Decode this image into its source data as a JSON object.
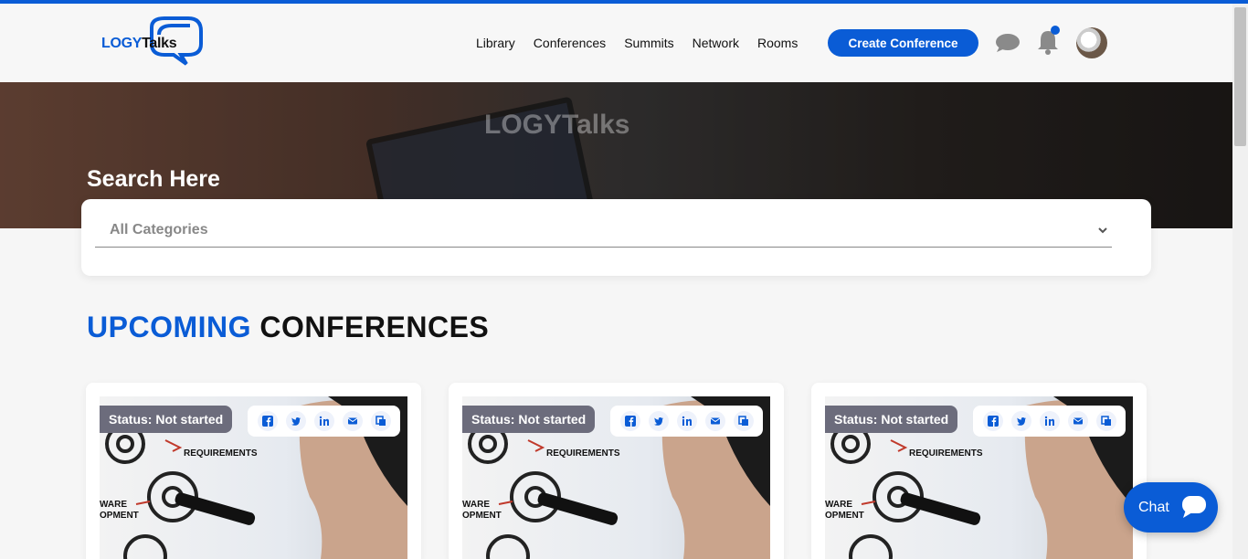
{
  "logo": {
    "part1": "LOGY",
    "part2": "Talks"
  },
  "nav": {
    "links": [
      "Library",
      "Conferences",
      "Summits",
      "Network",
      "Rooms"
    ],
    "create_label": "Create Conference",
    "icons": [
      "chat-icon",
      "bell-icon",
      "avatar"
    ],
    "accent_color": "#0a5cd6"
  },
  "hero": {
    "title": "Search Here",
    "watermark": "LOGYTalks"
  },
  "search": {
    "category_value": "All Categories"
  },
  "section": {
    "title_highlight": "UPCOMING",
    "title_rest": "CONFERENCES"
  },
  "cards": [
    {
      "status": "Status: Not started",
      "image_labels": [
        "REQUIREMENTS",
        "WARE",
        "OPMENT"
      ]
    },
    {
      "status": "Status: Not started",
      "image_labels": [
        "REQUIREMENTS",
        "WARE",
        "OPMENT"
      ]
    },
    {
      "status": "Status: Not started",
      "image_labels": [
        "REQUIREMENTS",
        "WARE",
        "OPMENT"
      ]
    }
  ],
  "share_icons": [
    "facebook-icon",
    "twitter-icon",
    "linkedin-icon",
    "email-icon",
    "copy-icon"
  ],
  "chat_widget": {
    "label": "Chat"
  }
}
